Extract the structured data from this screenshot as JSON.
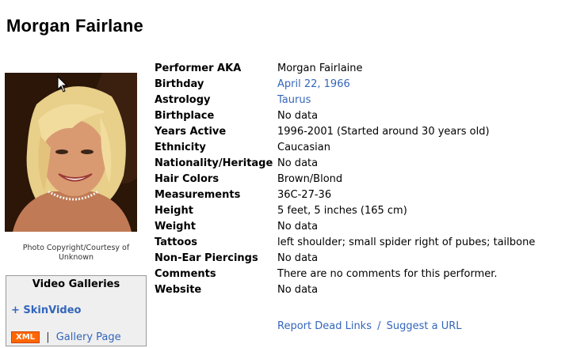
{
  "page": {
    "title": "Morgan Fairlane"
  },
  "photo": {
    "caption": "Photo Copyright/Courtesy of Unknown"
  },
  "galleries": {
    "title": "Video Galleries",
    "link_label": "+ SkinVideo",
    "xml_badge": "XML",
    "separator": "|",
    "gallery_page_label": "Gallery Page"
  },
  "info": {
    "rows": [
      {
        "label": "Performer AKA",
        "value": "Morgan Fairlaine"
      },
      {
        "label": "Birthday",
        "value": "April 22, 1966"
      },
      {
        "label": "Astrology",
        "value": "Taurus"
      },
      {
        "label": "Birthplace",
        "value": "No data"
      },
      {
        "label": "Years Active",
        "value": "1996-2001 (Started around 30 years old)"
      },
      {
        "label": "Ethnicity",
        "value": "Caucasian"
      },
      {
        "label": "Nationality/Heritage",
        "value": "No data"
      },
      {
        "label": "Hair Colors",
        "value": "Brown/Blond"
      },
      {
        "label": "Measurements",
        "value": "36C-27-36"
      },
      {
        "label": "Height",
        "value": "5 feet, 5 inches (165 cm)"
      },
      {
        "label": "Weight",
        "value": "No data"
      },
      {
        "label": "Tattoos",
        "value": "left shoulder; small spider right of pubes; tailbone"
      },
      {
        "label": "Non-Ear Piercings",
        "value": "No data"
      },
      {
        "label": "Comments",
        "value": "There are no comments for this performer."
      },
      {
        "label": "Website",
        "value": "No data"
      }
    ]
  },
  "footer": {
    "report_label": "Report Dead Links",
    "separator": "/",
    "suggest_label": "Suggest a URL"
  },
  "colors": {
    "link": "#3366bb",
    "xml_badge": "#ff6600",
    "box_bg": "#efefef"
  }
}
